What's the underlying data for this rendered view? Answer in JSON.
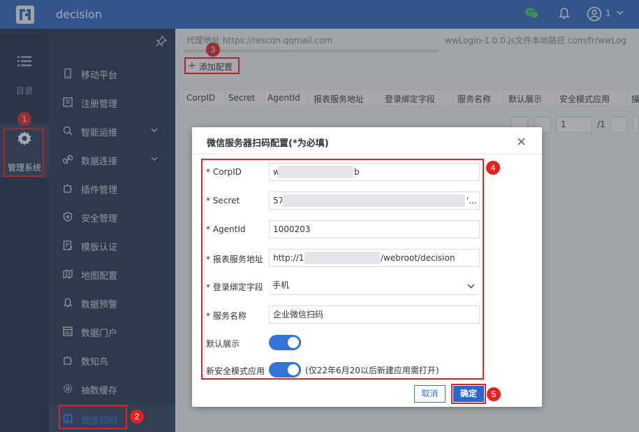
{
  "app": {
    "title": "decision",
    "user_label": "1"
  },
  "rail": {
    "directory_label": "目录",
    "management_label": "管理系统"
  },
  "sidebar": {
    "items": [
      {
        "label": "移动平台",
        "icon": "mobile-icon"
      },
      {
        "label": "注册管理",
        "icon": "register-icon"
      },
      {
        "label": "智能运维",
        "icon": "ops-icon",
        "expandable": true
      },
      {
        "label": "数据连接",
        "icon": "link-icon",
        "expandable": true
      },
      {
        "label": "插件管理",
        "icon": "puzzle-icon"
      },
      {
        "label": "安全管理",
        "icon": "shield-icon"
      },
      {
        "label": "模板认证",
        "icon": "template-icon"
      },
      {
        "label": "地图配置",
        "icon": "map-icon"
      },
      {
        "label": "数据预警",
        "icon": "bell-icon"
      },
      {
        "label": "数据门户",
        "icon": "portal-icon"
      },
      {
        "label": "数知鸟",
        "icon": "puzzle-icon"
      },
      {
        "label": "抽数缓存",
        "icon": "gear-icon"
      },
      {
        "label": "微信扫码",
        "icon": "logo-icon",
        "active": true
      }
    ]
  },
  "main": {
    "proxy_text": "代理地址 https://rescdn.qqmail.com",
    "proxy_text2": "wwLogin-1.0.0.js文件本地路径.com/fr/wwLog",
    "add_config_label": "添加配置",
    "table_headers": [
      "CorpID",
      "Secret",
      "AgentId",
      "报表服务地址",
      "登录绑定字段",
      "服务名称",
      "默认展示",
      "安全模式应用",
      "操"
    ],
    "pager": {
      "current": "1",
      "total": "/1"
    }
  },
  "dialog": {
    "title": "微信服务器扫码配置(*为必填)",
    "fields": {
      "corpid": {
        "label": "* CorpID",
        "value_start": "w",
        "value_end": "b"
      },
      "secret": {
        "label": "* Secret",
        "value_start": "57",
        "value_end": "'..."
      },
      "agentid": {
        "label": "* AgentId",
        "value": "1000203"
      },
      "report_url": {
        "label": "* 报表服务地址",
        "value_start": "http://1",
        "value_end": "/webroot/decision"
      },
      "bind_field": {
        "label": "* 登录绑定字段",
        "value": "手机"
      },
      "service_name": {
        "label": "* 服务名称",
        "value": "企业微信扫码"
      },
      "default_show": {
        "label": "默认展示",
        "on": true
      },
      "new_security": {
        "label": "新安全模式应用",
        "on": true,
        "hint": "(仅22年6月20以后新建应用需打开)"
      }
    },
    "cancel_label": "取消",
    "ok_label": "确定"
  },
  "markers": [
    "1",
    "2",
    "3",
    "4",
    "5"
  ],
  "colors": {
    "topbar": "#2b67c9",
    "sidebar": "#223553",
    "accent": "#3373d6",
    "annotation": "#e02424"
  }
}
